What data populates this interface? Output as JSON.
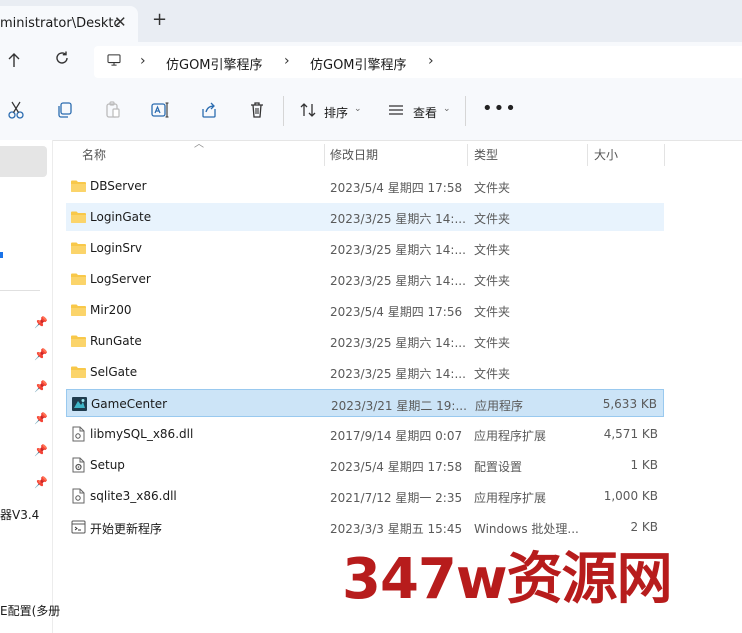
{
  "tab": {
    "title": "ministrator\\Desktc",
    "close": "✕",
    "new": "+"
  },
  "breadcrumb": {
    "items": [
      "仿GOM引擎程序",
      "仿GOM引擎程序"
    ]
  },
  "toolbar": {
    "sort_label": "排序",
    "view_label": "查看",
    "more": "•••"
  },
  "nav": {
    "items": [
      "器V3.4",
      "E配置(多册"
    ]
  },
  "columns": {
    "name": "名称",
    "date": "修改日期",
    "type": "类型",
    "size": "大小"
  },
  "files": [
    {
      "name": "DBServer",
      "date": "2023/5/4 星期四 17:58",
      "type": "文件夹",
      "size": "",
      "icon": "folder-icon"
    },
    {
      "name": "LoginGate",
      "date": "2023/3/25 星期六 14:...",
      "type": "文件夹",
      "size": "",
      "icon": "folder-icon"
    },
    {
      "name": "LoginSrv",
      "date": "2023/3/25 星期六 14:...",
      "type": "文件夹",
      "size": "",
      "icon": "folder-icon"
    },
    {
      "name": "LogServer",
      "date": "2023/3/25 星期六 14:...",
      "type": "文件夹",
      "size": "",
      "icon": "folder-icon"
    },
    {
      "name": "Mir200",
      "date": "2023/5/4 星期四 17:56",
      "type": "文件夹",
      "size": "",
      "icon": "folder-icon"
    },
    {
      "name": "RunGate",
      "date": "2023/3/25 星期六 14:...",
      "type": "文件夹",
      "size": "",
      "icon": "folder-icon"
    },
    {
      "name": "SelGate",
      "date": "2023/3/25 星期六 14:...",
      "type": "文件夹",
      "size": "",
      "icon": "folder-icon"
    },
    {
      "name": "GameCenter",
      "date": "2023/3/21 星期二 19:...",
      "type": "应用程序",
      "size": "5,633 KB",
      "icon": "app-icon"
    },
    {
      "name": "libmySQL_x86.dll",
      "date": "2017/9/14 星期四 0:07",
      "type": "应用程序扩展",
      "size": "4,571 KB",
      "icon": "dll-icon"
    },
    {
      "name": "Setup",
      "date": "2023/5/4 星期四 17:58",
      "type": "配置设置",
      "size": "1 KB",
      "icon": "config-icon"
    },
    {
      "name": "sqlite3_x86.dll",
      "date": "2021/7/12 星期一 2:35",
      "type": "应用程序扩展",
      "size": "1,000 KB",
      "icon": "dll-icon"
    },
    {
      "name": "开始更新程序",
      "date": "2023/3/3 星期五 15:45",
      "type": "Windows 批处理...",
      "size": "2 KB",
      "icon": "batch-icon"
    }
  ],
  "watermark": {
    "text": "347w资源网"
  },
  "colors": {
    "folder": "#f8c84a",
    "selection": "#cce4f7",
    "hover": "#e8f3fd",
    "watermark": "#b71c1c"
  }
}
